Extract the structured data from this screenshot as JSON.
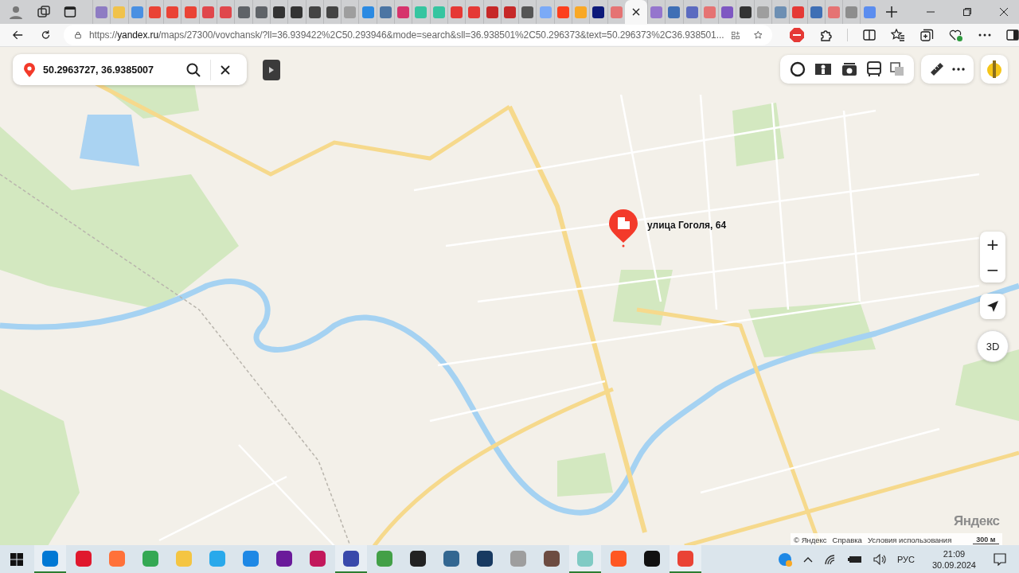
{
  "tabs": [
    {
      "color": "#8e7cc3",
      "selected": false
    },
    {
      "color": "#f0c24b",
      "selected": false
    },
    {
      "color": "#4a90e2",
      "selected": false
    },
    {
      "color": "#ea4335",
      "selected": false
    },
    {
      "color": "#ea4335",
      "selected": false
    },
    {
      "color": "#ea4335",
      "selected": false
    },
    {
      "color": "#e0474c",
      "selected": false
    },
    {
      "color": "#e0474c",
      "selected": false
    },
    {
      "color": "#5f6368",
      "selected": false
    },
    {
      "color": "#5f6368",
      "selected": false
    },
    {
      "color": "#333333",
      "selected": false
    },
    {
      "color": "#333333",
      "selected": false
    },
    {
      "color": "#444444",
      "selected": false
    },
    {
      "color": "#444444",
      "selected": false
    },
    {
      "color": "#9e9e9e",
      "selected": false
    },
    {
      "color": "#2b8ae2",
      "selected": false
    },
    {
      "color": "#4c75a3",
      "selected": false
    },
    {
      "color": "#d6336c",
      "selected": false
    },
    {
      "color": "#36c5a0",
      "selected": false
    },
    {
      "color": "#36c5a0",
      "selected": false
    },
    {
      "color": "#e53935",
      "selected": false
    },
    {
      "color": "#e53935",
      "selected": false
    },
    {
      "color": "#c62828",
      "selected": false
    },
    {
      "color": "#c62828",
      "selected": false
    },
    {
      "color": "#555555",
      "selected": false
    },
    {
      "color": "#7baaf7",
      "selected": false
    },
    {
      "color": "#fc3f1d",
      "selected": false
    },
    {
      "color": "#f9a825",
      "selected": false
    },
    {
      "color": "#0d1a7a",
      "selected": false
    },
    {
      "color": "#e57373",
      "selected": false
    },
    {
      "selected": true
    },
    {
      "color": "#9575cd",
      "selected": false
    },
    {
      "color": "#3f6fb5",
      "selected": false
    },
    {
      "color": "#5c6bc0",
      "selected": false
    },
    {
      "color": "#e57373",
      "selected": false
    },
    {
      "color": "#7e57c2",
      "selected": false
    },
    {
      "color": "#333333",
      "selected": false
    },
    {
      "color": "#9e9e9e",
      "selected": false
    },
    {
      "color": "#6d8fb3",
      "selected": false
    },
    {
      "color": "#e53935",
      "selected": false
    },
    {
      "color": "#3f6fb5",
      "selected": false
    },
    {
      "color": "#e57373",
      "selected": false
    },
    {
      "color": "#8d8d8d",
      "selected": false
    },
    {
      "color": "#5b8def",
      "selected": false
    }
  ],
  "address_bar": {
    "url": "https://**yandex.ru**/maps/27300/vovchansk/?ll=36.939422%2C50.293946&mode=search&sll=36.938501%2C50.296373&text=50.296373%2C36.938501..."
  },
  "search": {
    "value": "50.2963727, 36.9385007"
  },
  "pin": {
    "label": "улица Гоголя, 64"
  },
  "attribution": [
    "© Яндекс",
    "Справка",
    "Условия использования"
  ],
  "scale": "300 м",
  "logo": "Яндекс",
  "zoom": {
    "in": "+",
    "out": "−"
  },
  "view_3d": "3D",
  "taskbar": [
    {
      "color": "#0078d4",
      "active": true
    },
    {
      "color": "#e0182d",
      "active": false
    },
    {
      "color": "#ff7139",
      "active": false
    },
    {
      "color": "#34a853",
      "active": false
    },
    {
      "color": "#f4c542",
      "active": false
    },
    {
      "color": "#29a9eb",
      "active": false
    },
    {
      "color": "#1e88e5",
      "active": false
    },
    {
      "color": "#6a1b9a",
      "active": false
    },
    {
      "color": "#c2185b",
      "active": false
    },
    {
      "color": "#3949ab",
      "active": true
    },
    {
      "color": "#43a047",
      "active": false
    },
    {
      "color": "#222222",
      "active": false
    },
    {
      "color": "#336791",
      "active": false
    },
    {
      "color": "#183a61",
      "active": false
    },
    {
      "color": "#9e9e9e",
      "active": false
    },
    {
      "color": "#6d4c41",
      "active": false
    },
    {
      "color": "#80cbc4",
      "active": true
    },
    {
      "color": "#ff5722",
      "active": false
    },
    {
      "color": "#111111",
      "active": false
    },
    {
      "color": "#ea4335",
      "active": true
    }
  ],
  "tray": {
    "language": "РУС",
    "time": "21:09",
    "date": "30.09.2024"
  }
}
